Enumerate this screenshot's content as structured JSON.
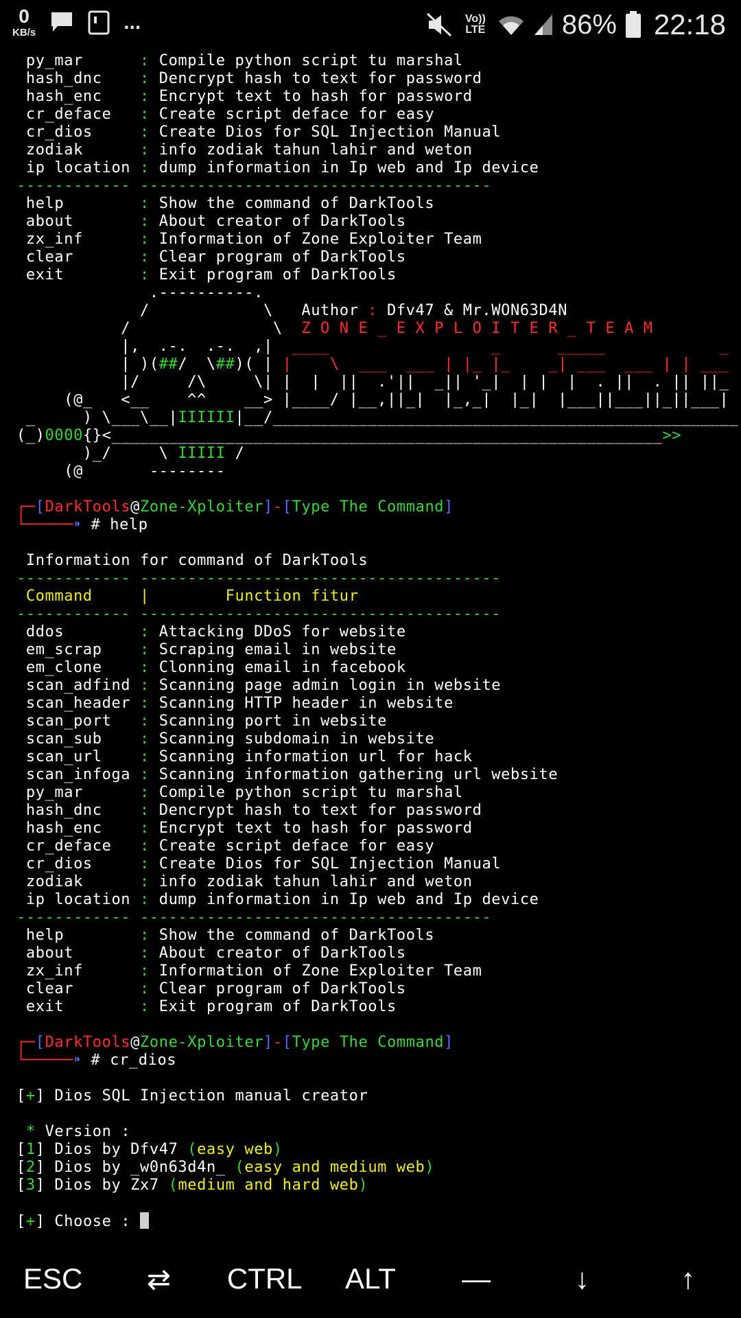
{
  "statusbar": {
    "net_speed": "0",
    "net_unit": "KB/s",
    "dots": "...",
    "lte_label": "Vo)) LTE",
    "battery": "86%",
    "time": "22:18"
  },
  "terminal": {
    "commands_1": [
      {
        "name": "py_mar      ",
        "desc": "Compile python script tu marshal"
      },
      {
        "name": "hash_dnc    ",
        "desc": "Dencrypt hash to text for password"
      },
      {
        "name": "hash_enc    ",
        "desc": "Encrypt text to hash for password"
      },
      {
        "name": "cr_deface   ",
        "desc": "Create script deface for easy"
      },
      {
        "name": "cr_dios     ",
        "desc": "Create Dios for SQL Injection Manual"
      },
      {
        "name": "zodiak      ",
        "desc": "info zodiak tahun lahir and weton"
      },
      {
        "name": "ip location ",
        "desc": "dump information in Ip web and Ip device"
      }
    ],
    "separator": "------------ -------------------------------------",
    "separator_long": "------------ --------------------------------------",
    "utility_1": [
      {
        "name": "help        ",
        "desc": "Show the command of DarkTools"
      },
      {
        "name": "about       ",
        "desc": "About creator of DarkTools"
      },
      {
        "name": "zx_inf      ",
        "desc": "Information of Zone Exploiter Team"
      },
      {
        "name": "clear       ",
        "desc": "Clear program of DarkTools"
      },
      {
        "name": "exit        ",
        "desc": "Exit program of DarkTools"
      }
    ],
    "banner": {
      "l1": "              .----------.",
      "l2": "             /            \\   ",
      "author_label": "Author ",
      "author_value": "Dfv47 & Mr.WON63D4N",
      "l3": "           /               \\  ",
      "team": "Z O N E _ E X P L O I T E R _ T E A M",
      "l4": "           |,  .-.  .-.  ,|  ",
      "l4r": "____                 _      _____            _",
      "l5a": "           | )(",
      "l5b": "##",
      "l5c": "/  \\",
      "l5d": "##",
      "l5e": ")( | ",
      "l5r": "|    \\  ___  ___ | |_ |_    _| ___  ___ | | ___",
      "l6": "           |/     /\\     \\| ",
      "l6r": "|  |  ||  .'||  _|| '_|  | |  |  . ||  . || ||_ -|",
      "l7": "     (@_   <__    ^^    __> ",
      "l7r": "|____/ |__,||_|  |_,_|  |_|  |___||___||_||___|",
      "l8a": " _     ) \\___\\__|",
      "l8b": "IIIIII",
      "l8c": "|__/_________________________________________________",
      "l9a": "(_)",
      "l9b": "0000",
      "l9c": "{}<__________________________________________________________",
      "l9d": ">>",
      "l10a": "       )_/     \\ ",
      "l10b": "IIIII",
      "l10c": " /",
      "l11": "     (@       --------"
    },
    "prompt": {
      "corner": "┌─",
      "lb": "[",
      "user": "DarkTools",
      "at": "@",
      "host": "Zone-Xploiter",
      "rb": "]",
      "dash": "-",
      "lb2": "[",
      "msg": "Type The Command",
      "rb2": "]",
      "corner2": "└─────",
      "arrow": "⁍",
      "hash": " # "
    },
    "cmd_help": "help",
    "info_title": "Information for command of DarkTools",
    "header_command": "Command",
    "header_sep": "     |        ",
    "header_function": "Function fitur",
    "commands_full": [
      {
        "name": "ddos        ",
        "desc": "Attacking DDoS for website"
      },
      {
        "name": "em_scrap    ",
        "desc": "Scraping email in website"
      },
      {
        "name": "em_clone    ",
        "desc": "Clonning email in facebook"
      },
      {
        "name": "scan_adfind ",
        "desc": "Scanning page admin login in website"
      },
      {
        "name": "scan_header ",
        "desc": "Scanning HTTP header in website"
      },
      {
        "name": "scan_port   ",
        "desc": "Scanning port in website"
      },
      {
        "name": "scan_sub    ",
        "desc": "Scanning subdomain in website"
      },
      {
        "name": "scan_url    ",
        "desc": "Scanning information url for hack"
      },
      {
        "name": "scan_infoga ",
        "desc": "Scanning information gathering url website"
      },
      {
        "name": "py_mar      ",
        "desc": "Compile python script tu marshal"
      },
      {
        "name": "hash_dnc    ",
        "desc": "Dencrypt hash to text for password"
      },
      {
        "name": "hash_enc    ",
        "desc": "Encrypt text to hash for password"
      },
      {
        "name": "cr_deface   ",
        "desc": "Create script deface for easy"
      },
      {
        "name": "cr_dios     ",
        "desc": "Create Dios for SQL Injection Manual"
      },
      {
        "name": "zodiak      ",
        "desc": "info zodiak tahun lahir and weton"
      },
      {
        "name": "ip location ",
        "desc": "dump information in Ip web and Ip device"
      }
    ],
    "utility_2": [
      {
        "name": "help        ",
        "desc": "Show the command of DarkTools"
      },
      {
        "name": "about       ",
        "desc": "About creator of DarkTools"
      },
      {
        "name": "zx_inf      ",
        "desc": "Information of Zone Exploiter Team"
      },
      {
        "name": "clear       ",
        "desc": "Clear program of DarkTools"
      },
      {
        "name": "exit        ",
        "desc": "Exit program of DarkTools"
      }
    ],
    "cmd_dios": "cr_dios",
    "plus": "+",
    "dios_title": "Dios SQL Injection manual creator",
    "star": "*",
    "version_label": "Version :",
    "options": [
      {
        "num": "1",
        "text": "Dios by Dfv47 ",
        "detail": "easy web"
      },
      {
        "num": "2",
        "text": "Dios by _w0n63d4n_ ",
        "detail": "easy and medium web"
      },
      {
        "num": "3",
        "text": "Dios by Zx7 ",
        "detail": "medium and hard web"
      }
    ],
    "choose_label": "Choose : "
  },
  "keys": [
    "ESC",
    "⇄",
    "CTRL",
    "ALT",
    "—",
    "↓",
    "↑"
  ]
}
